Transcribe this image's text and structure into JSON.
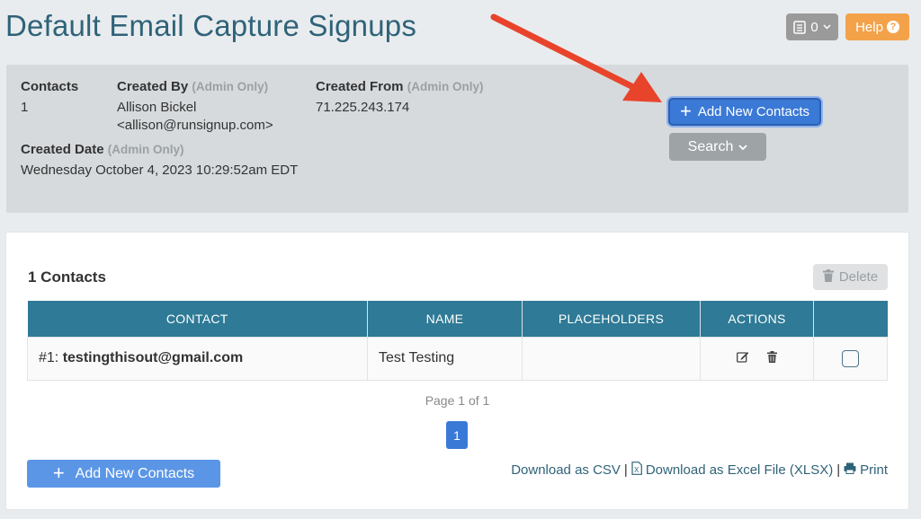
{
  "page": {
    "title": "Default Email Capture Signups"
  },
  "top_actions": {
    "cart_count": "0",
    "help_label": "Help"
  },
  "info": {
    "contacts_label": "Contacts",
    "contacts_value": "1",
    "created_by_label": "Created By",
    "created_by_admin": "(Admin Only)",
    "created_by_name": "Allison Bickel",
    "created_by_email": "<allison@runsignup.com>",
    "created_from_label": "Created From",
    "created_from_admin": "(Admin Only)",
    "created_from_value": "71.225.243.174",
    "created_date_label": "Created Date",
    "created_date_admin": "(Admin Only)",
    "created_date_value": "Wednesday October 4, 2023 10:29:52am EDT"
  },
  "buttons": {
    "add_new_contacts": "Add New Contacts",
    "search": "Search",
    "delete": "Delete"
  },
  "list": {
    "count_label": "1 Contacts",
    "columns": [
      "CONTACT",
      "NAME",
      "PLACEHOLDERS",
      "ACTIONS",
      ""
    ],
    "rows": [
      {
        "prefix": "#1: ",
        "email": "testingthisout@gmail.com",
        "name": "Test Testing",
        "placeholders": ""
      }
    ],
    "page_info": "Page 1 of 1",
    "current_page": "1"
  },
  "downloads": {
    "csv": "Download as CSV",
    "excel": "Download as Excel File (XLSX)",
    "print": "Print",
    "separator": "|"
  },
  "colors": {
    "title": "#2f6378",
    "primary": "#3b79d6",
    "header": "#2f7a96",
    "help": "#f4a24a",
    "arrow": "#e8442b"
  },
  "icons": [
    "list-icon",
    "chevron-down-icon",
    "question-icon",
    "plus-icon",
    "trash-icon",
    "edit-icon",
    "excel-file-icon",
    "print-icon",
    "annotation-arrow"
  ]
}
